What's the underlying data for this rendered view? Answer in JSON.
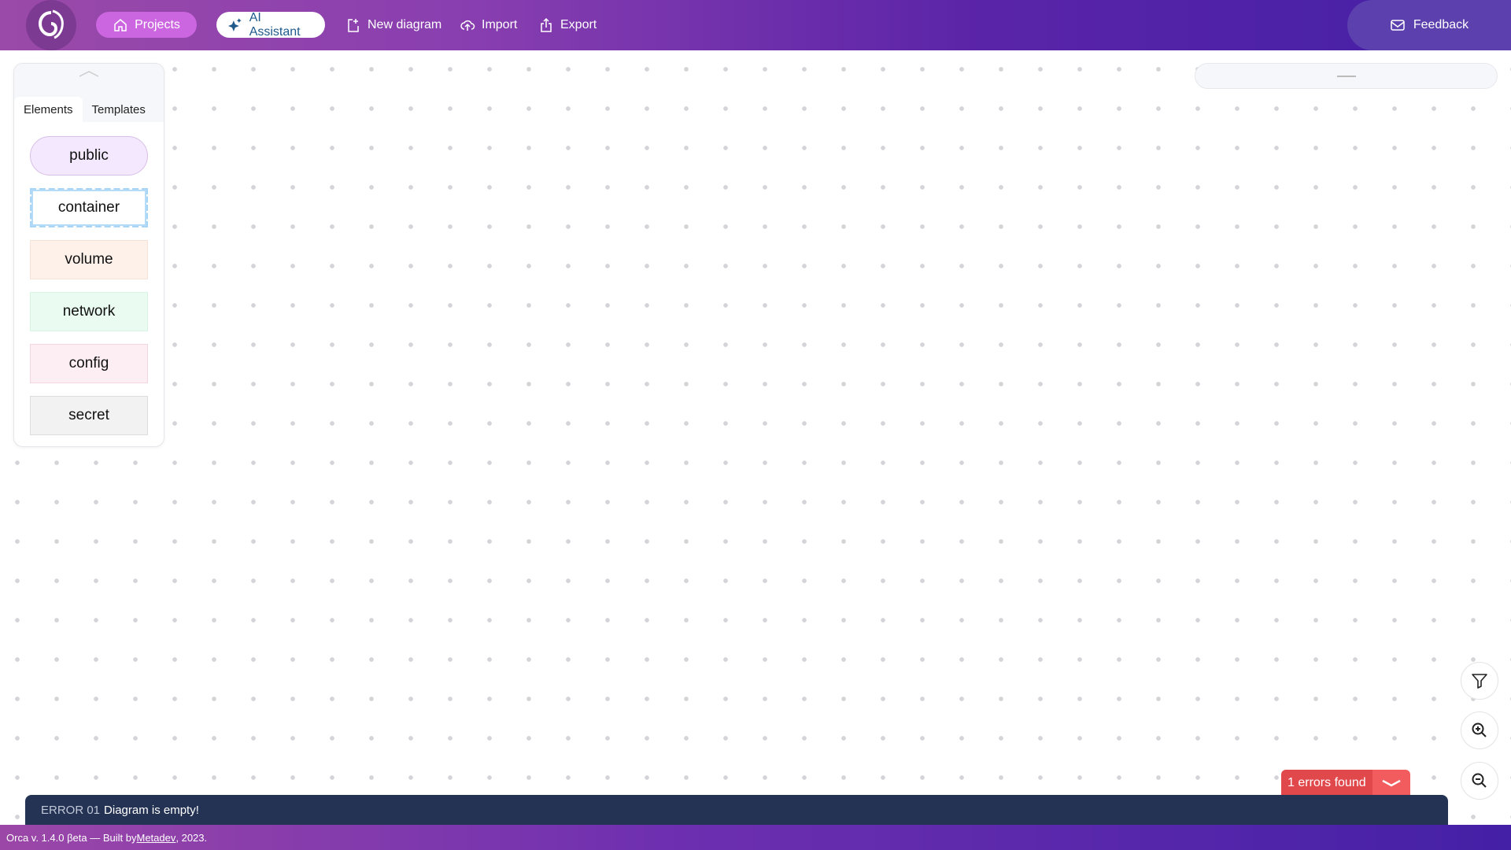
{
  "header": {
    "nav": [
      {
        "label": "Projects",
        "icon": "home-icon"
      },
      {
        "label": "AI Assistant",
        "icon": "sparkles-icon"
      },
      {
        "label": "New diagram",
        "icon": "new-file-icon"
      },
      {
        "label": "Import",
        "icon": "cloud-upload-icon"
      },
      {
        "label": "Export",
        "icon": "share-icon"
      }
    ],
    "feedback": "Feedback"
  },
  "sidebar": {
    "tabs": [
      "Elements",
      "Templates"
    ],
    "active_tab": "Elements",
    "items": [
      {
        "label": "public",
        "color": "#f3e8fd"
      },
      {
        "label": "container",
        "color": "#ffffff"
      },
      {
        "label": "volume",
        "color": "#fdf1ea"
      },
      {
        "label": "network",
        "color": "#eafcf1"
      },
      {
        "label": "config",
        "color": "#fdeef3"
      },
      {
        "label": "secret",
        "color": "#f2f2f3"
      }
    ]
  },
  "errors": {
    "badge": "1 errors found",
    "code": "ERROR 01",
    "message": "Diagram is empty!"
  },
  "footer": {
    "prefix": "Orca v. 1.4.0 βeta — Built by ",
    "link": "Metadev",
    "suffix": ", 2023."
  },
  "colors": {
    "error": "#e0484c",
    "errorbar": "#243354",
    "accent": "#cc66e0"
  }
}
